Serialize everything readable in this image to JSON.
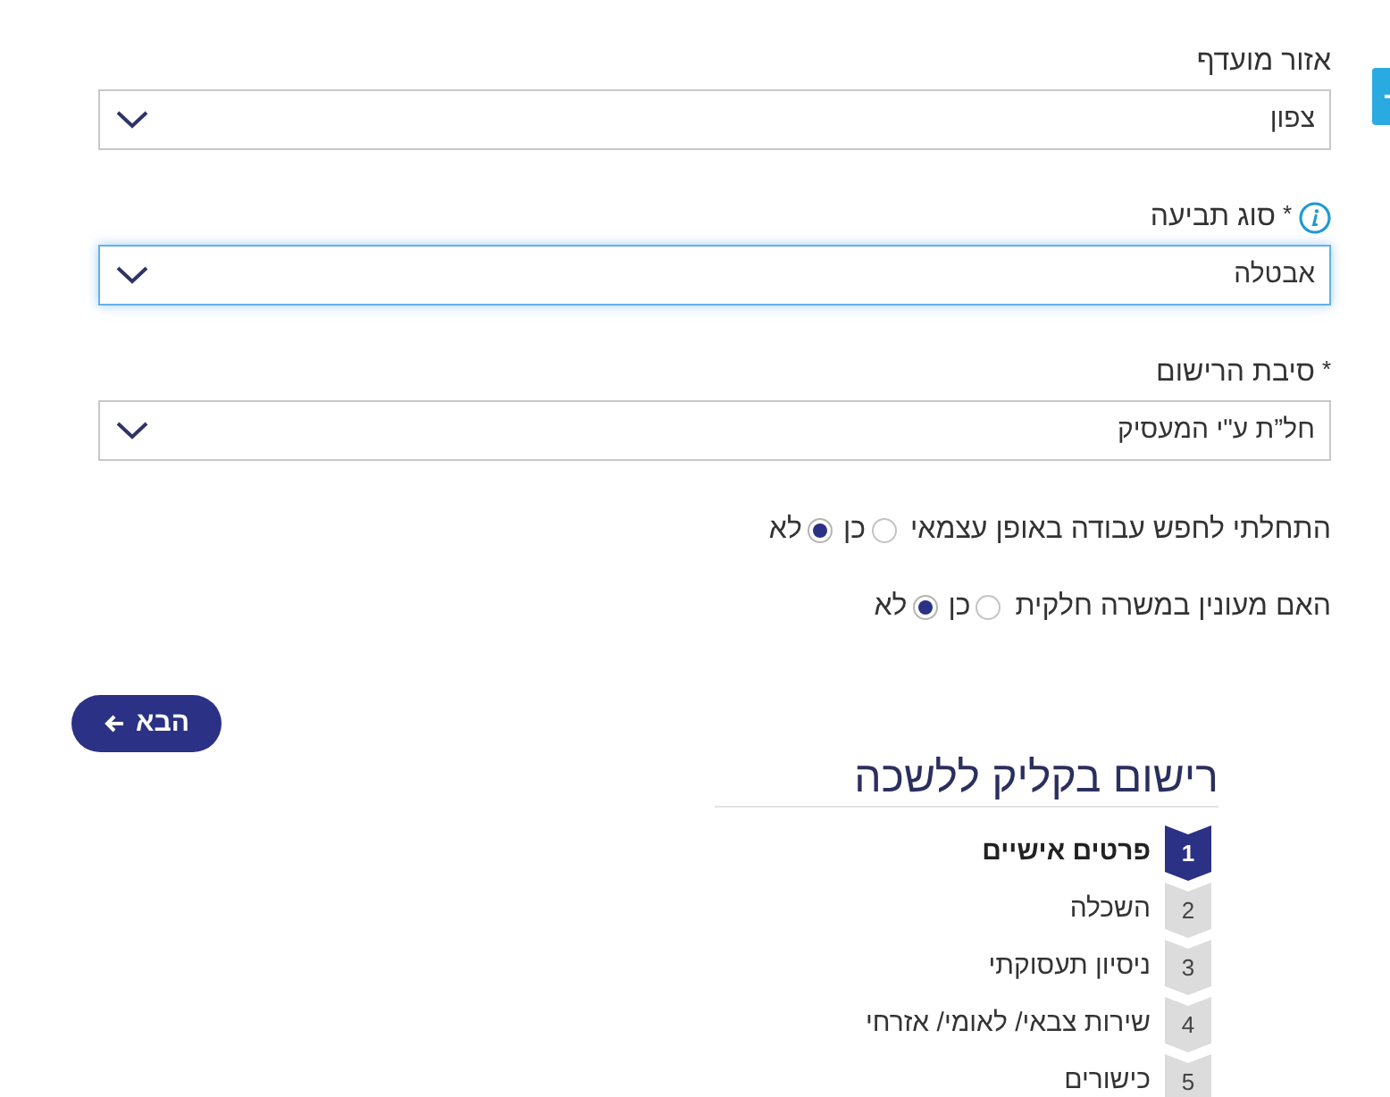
{
  "fields": [
    {
      "label": "אזור מועדף",
      "info": false,
      "value": "צפון",
      "focused": false
    },
    {
      "label": "סוג תביעה",
      "required_mark": "*",
      "info": true,
      "value": "אבטלה",
      "focused": true
    },
    {
      "label": "סיבת הרישום",
      "required_mark": "*",
      "info": false,
      "value": "חל”ת ע\"י המעסיק",
      "focused": false
    }
  ],
  "questions": [
    {
      "label": "התחלתי לחפש עבודה באופן עצמאי",
      "options": [
        {
          "label": "כן",
          "selected": false
        },
        {
          "label": "לא",
          "selected": true
        }
      ]
    },
    {
      "label": "האם מעונין במשרה חלקית",
      "options": [
        {
          "label": "כן",
          "selected": false
        },
        {
          "label": "לא",
          "selected": true
        }
      ]
    }
  ],
  "next_button": {
    "label": "הבא"
  },
  "steps_panel": {
    "title": "רישום בקליק ללשכה",
    "steps": [
      {
        "number": "1",
        "label": "פרטים אישיים",
        "selected": true
      },
      {
        "number": "2",
        "label": "השכלה",
        "selected": false
      },
      {
        "number": "3",
        "label": "ניסיון תעסוקתי",
        "selected": false
      },
      {
        "number": "4",
        "label": "שירות צבאי/ לאומי/ אזרחי",
        "selected": false
      },
      {
        "number": "5",
        "label": "כישורים",
        "selected": false
      }
    ]
  }
}
